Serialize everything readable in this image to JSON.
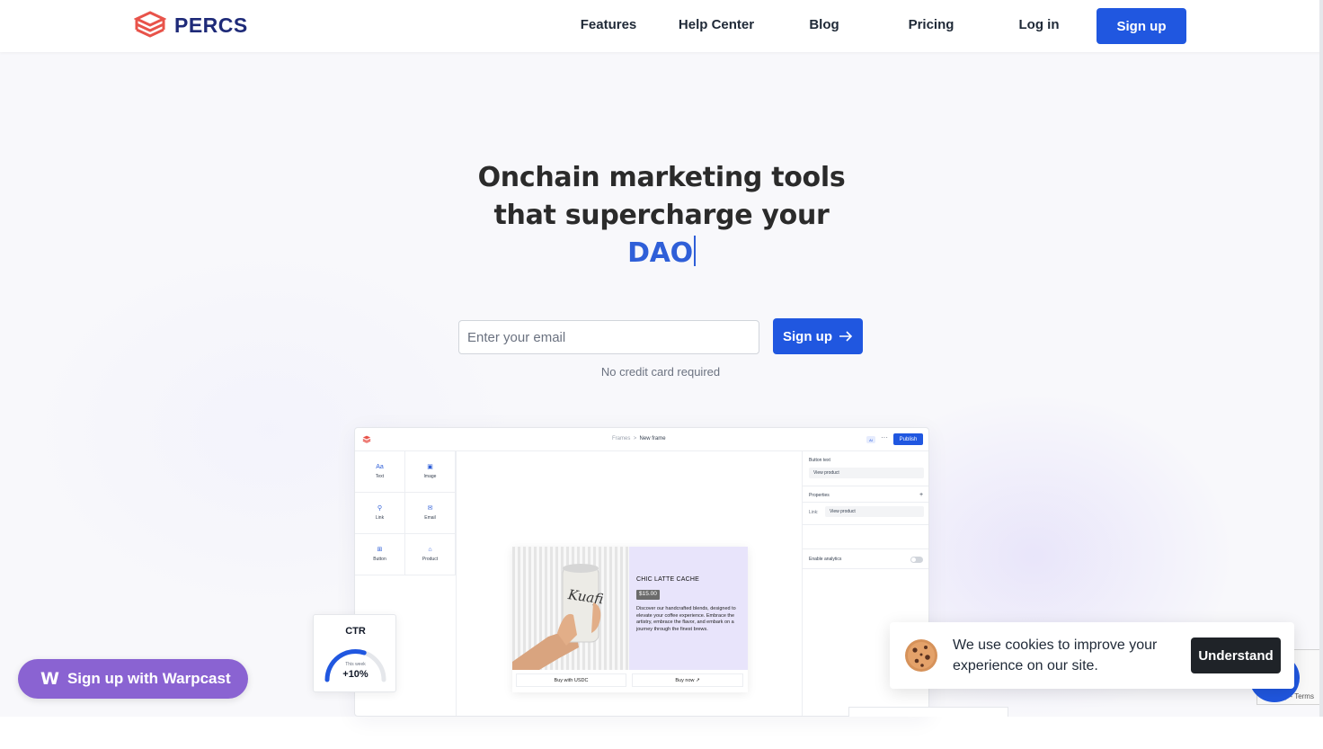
{
  "brand": {
    "name": "PERCS",
    "accent": "#2057e0",
    "logo_color": "#e8534a"
  },
  "nav": {
    "links": [
      "Features",
      "Help Center",
      "Blog",
      "Pricing",
      "Log in"
    ],
    "signup_label": "Sign up"
  },
  "hero": {
    "title_line1": "Onchain marketing tools",
    "title_line2": "that supercharge your",
    "rotating_word": "DAO",
    "email_placeholder": "Enter your email",
    "signup_label": "Sign up",
    "note": "No credit card required"
  },
  "editor": {
    "breadcrumb_root": "Frames",
    "breadcrumb_sep": ">",
    "breadcrumb_current": "New frame",
    "ai_badge": "AI",
    "more": "···",
    "publish_label": "Publish",
    "tools": [
      {
        "label": "Text",
        "icon": "text-icon",
        "glyph": "Aa"
      },
      {
        "label": "Image",
        "icon": "image-icon",
        "glyph": "▣"
      },
      {
        "label": "Link",
        "icon": "link-icon",
        "glyph": "⚲"
      },
      {
        "label": "Email",
        "icon": "mail-icon",
        "glyph": "✉"
      },
      {
        "label": "Button",
        "icon": "button-icon",
        "glyph": "⊞"
      },
      {
        "label": "Product",
        "icon": "bag-icon",
        "glyph": "⌂"
      }
    ],
    "panel": {
      "button_text_label": "Button text",
      "button_text_value": "View product",
      "properties_label": "Properties",
      "add": "+",
      "link_label": "Link:",
      "link_value": "View product",
      "analytics_label": "Enable analytics",
      "analytics_enabled": false
    },
    "card": {
      "can_label": "Kuafi",
      "title": "CHIC LATTE CACHE",
      "price": "$15.00",
      "description": "Discover our handcrafted blends, designed to elevate your coffee experience. Embrace the artistry, embrace the flavor, and embark on a journey through the finest brews.",
      "button_usdc": "Buy with USDC",
      "button_buy": "Buy now ↗"
    }
  },
  "ctr_widget": {
    "title": "CTR",
    "period": "This week",
    "value": "+10%",
    "gauge_fraction": 0.6
  },
  "warpcast": {
    "label": "Sign up with Warpcast",
    "color": "#8a63d2"
  },
  "cookie": {
    "text": "We use cookies to improve your experience on our site.",
    "button_label": "Understand"
  },
  "recaptcha": {
    "terms": "Privacy - Terms"
  }
}
